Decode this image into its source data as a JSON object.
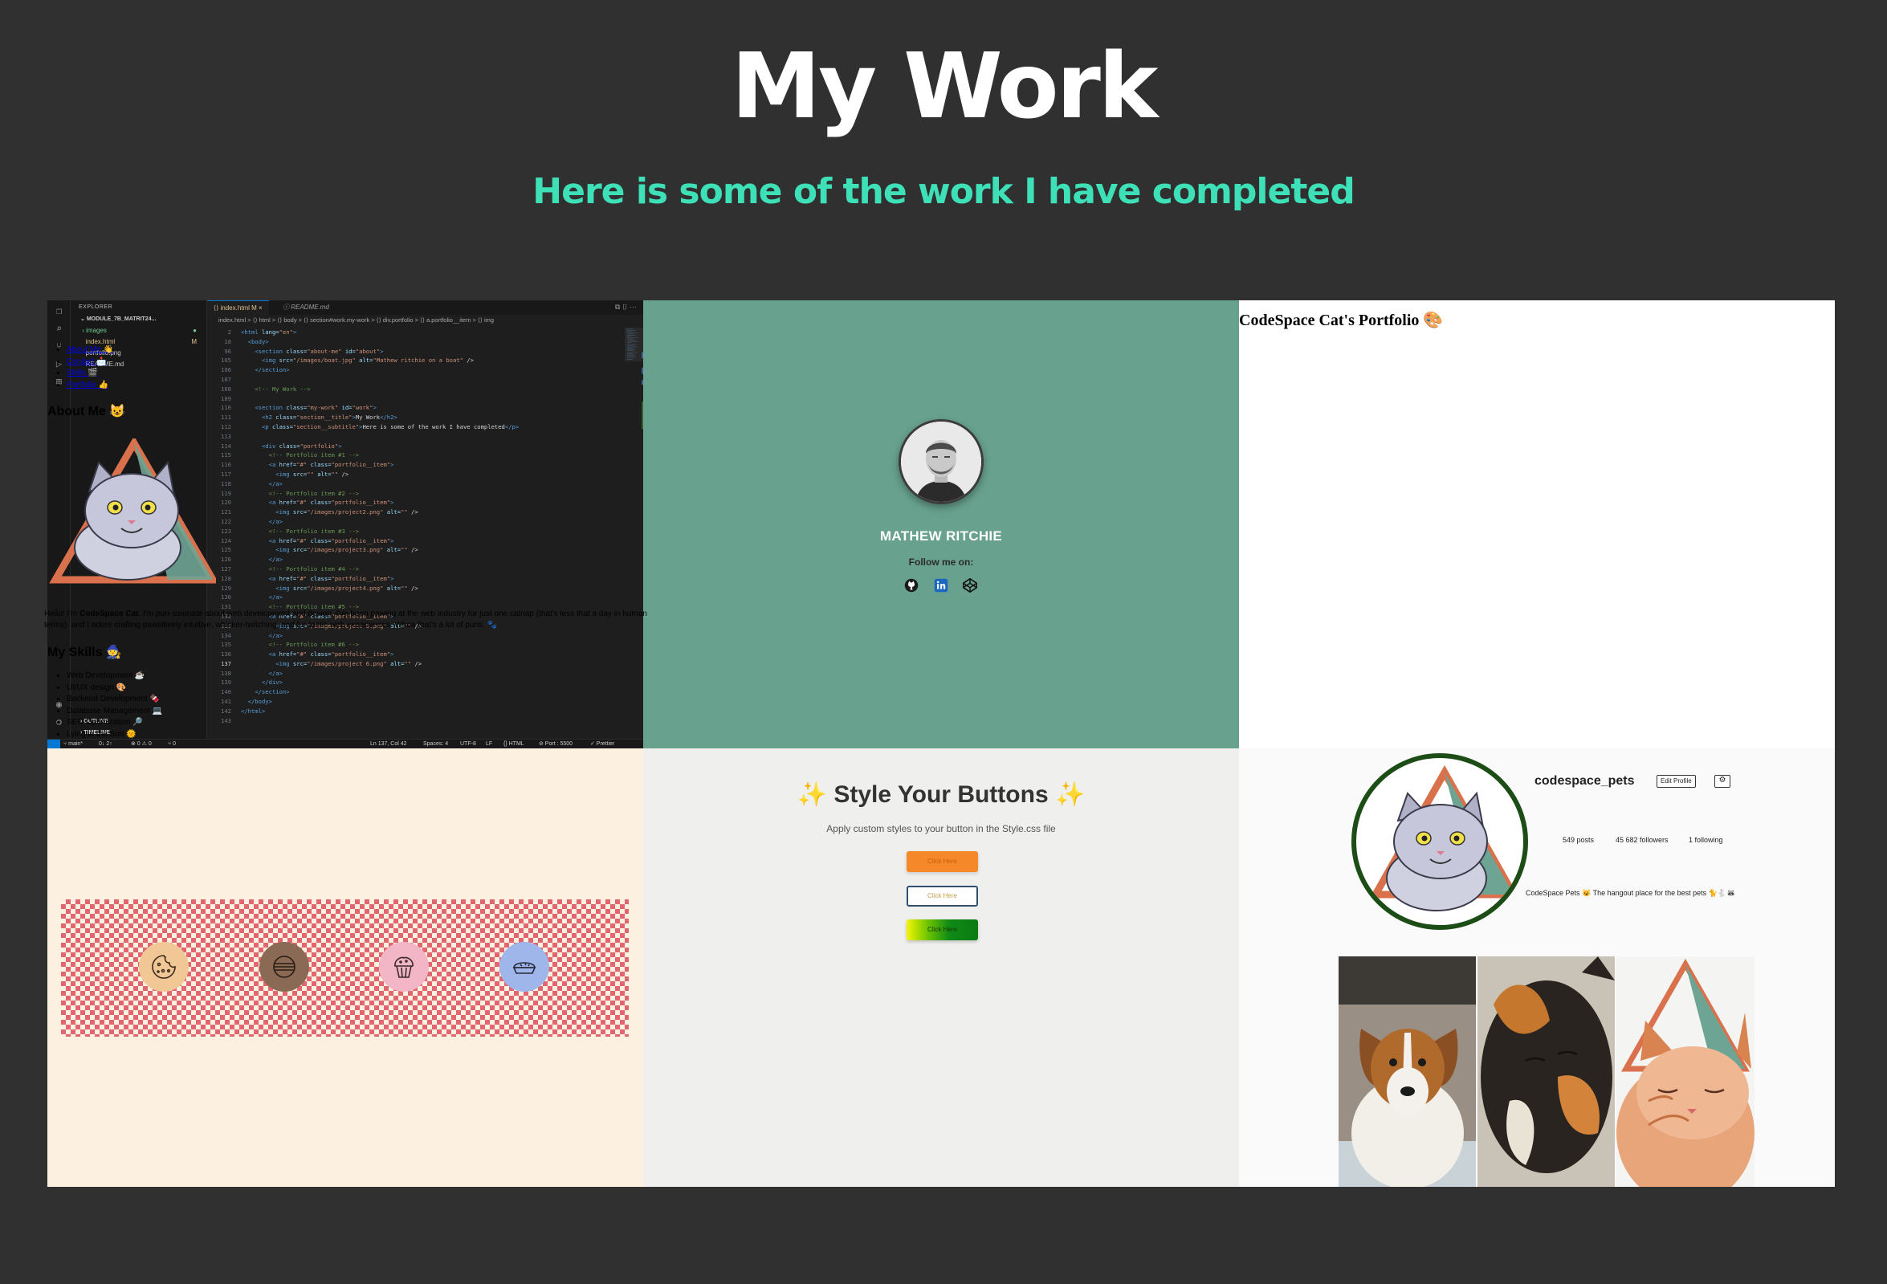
{
  "header": {
    "title": "My Work",
    "subtitle": "Here is some of the work I have completed"
  },
  "portfolio": {
    "item1": {
      "explorer_label": "EXPLORER",
      "project_folder": "MODULE_7B_MATRIT24...",
      "files": [
        {
          "name": "images",
          "mark": "●"
        },
        {
          "name": "index.html",
          "mark": "M"
        },
        {
          "name": "portfolio.png",
          "mark": ""
        },
        {
          "name": "README.md",
          "mark": ""
        }
      ],
      "outline_label": "OUTLINE",
      "timeline_label": "TIMELINE",
      "tabs": [
        "index.html M",
        "README.md"
      ],
      "breadcrumbs": "index.html  >  ⟨⟩ html  >  ⟨⟩ body  >  ⟨⟩ section#work.my-work  >  ⟨⟩ div.portfolio  >  ⟨⟩ a.portfolio__item  >  ⟨⟩ img",
      "code_lines": [
        {
          "n": "2",
          "t": "<html lang=\"en\">"
        },
        {
          "n": "18",
          "t": "  <body>"
        },
        {
          "n": "96",
          "t": "    <section class=\"about-me\" id=\"about\">"
        },
        {
          "n": "105",
          "t": "      <img src=\"/images/boat.jpg\" alt=\"Mathew ritchie on a boat\" />"
        },
        {
          "n": "106",
          "t": "    </section>"
        },
        {
          "n": "107",
          "t": ""
        },
        {
          "n": "108",
          "t": "    <!-- My Work -->"
        },
        {
          "n": "109",
          "t": ""
        },
        {
          "n": "110",
          "t": "    <section class=\"my-work\" id=\"work\">"
        },
        {
          "n": "111",
          "t": "      <h2 class=\"section__title\">My Work</h2>"
        },
        {
          "n": "112",
          "t": "      <p class=\"section__subtitle\">Here is some of the work I have completed</p>"
        },
        {
          "n": "113",
          "t": ""
        },
        {
          "n": "114",
          "t": "      <div class=\"portfolio\">"
        },
        {
          "n": "115",
          "t": "        <!-- Portfolio item #1 -->"
        },
        {
          "n": "116",
          "t": "        <a href=\"#\" class=\"portfolio__item\">"
        },
        {
          "n": "117",
          "t": "          <img src=\"\" alt=\"\" />"
        },
        {
          "n": "118",
          "t": "        </a>"
        },
        {
          "n": "119",
          "t": "        <!-- Portfolio item #2 -->"
        },
        {
          "n": "120",
          "t": "        <a href=\"#\" class=\"portfolio__item\">"
        },
        {
          "n": "121",
          "t": "          <img src=\"/images/project2.png\" alt=\"\" />"
        },
        {
          "n": "122",
          "t": "        </a>"
        },
        {
          "n": "123",
          "t": "        <!-- Portfolio item #3 -->"
        },
        {
          "n": "124",
          "t": "        <a href=\"#\" class=\"portfolio__item\">"
        },
        {
          "n": "125",
          "t": "          <img src=\"/images/project3.png\" alt=\"\" />"
        },
        {
          "n": "126",
          "t": "        </a>"
        },
        {
          "n": "127",
          "t": "        <!-- Portfolio item #4 -->"
        },
        {
          "n": "128",
          "t": "        <a href=\"#\" class=\"portfolio__item\">"
        },
        {
          "n": "129",
          "t": "          <img src=\"/images/project4.png\" alt=\"\" />"
        },
        {
          "n": "130",
          "t": "        </a>"
        },
        {
          "n": "131",
          "t": "        <!-- Portfolio item #5 -->"
        },
        {
          "n": "132",
          "t": "        <a href=\"#\" class=\"portfolio__item\">"
        },
        {
          "n": "133",
          "t": "          <img src=\"/images/project 5.png\" alt=\"\" />"
        },
        {
          "n": "134",
          "t": "        </a>"
        },
        {
          "n": "135",
          "t": "        <!-- Portfolio item #6 -->"
        },
        {
          "n": "136",
          "t": "        <a href=\"#\" class=\"portfolio__item\">"
        },
        {
          "n": "137",
          "t": "          <img src=\"/images/project 6.png\" alt=\"\" />"
        },
        {
          "n": "138",
          "t": "        </a>"
        },
        {
          "n": "139",
          "t": "      </div>"
        },
        {
          "n": "140",
          "t": "    </section>"
        },
        {
          "n": "141",
          "t": "  </body>"
        },
        {
          "n": "142",
          "t": "</html>"
        },
        {
          "n": "143",
          "t": ""
        }
      ],
      "status": {
        "branch": "main*",
        "sync": "0↓ 2↑",
        "problems": "⊗ 0 ⚠ 0",
        "ports": "⑂ 0",
        "position": "Ln 137, Col 42",
        "spaces": "Spaces: 4",
        "encoding": "UTF-8",
        "eol": "LF",
        "language": "{} HTML",
        "port": "⊘ Port : 5500",
        "prettier": "✓ Prettier"
      }
    },
    "item2": {
      "name": "MATHEW RITCHIE",
      "follow": "Follow me on:",
      "background": "#68a28f"
    },
    "item3": {
      "title": "CodeSpace Cat's Portfolio 🎨",
      "nav": [
        "About Me 👋",
        "Contact 📩",
        "Skills 🎬",
        "Portfolio 👍"
      ],
      "about_heading": "About Me 😺",
      "about_text_1": "Hello! I'm ",
      "about_bold": "CodeSpace Cat",
      "about_text_2": ". I'm purr-ssionate about web development and design. I've been pawing at the web industry for just one catnap (that's less that a day in human",
      "about_text_3": "terms). and I adore crafting pawsitively intuitive, whisker-twitching, and fur-tastic web experiences. Whoa that's a lot of puns. 🐾",
      "skills_heading": "My Skills 🧙",
      "skills": [
        "Web Development ☕",
        "UI/UX design 🎨",
        "Backend Development 🍫",
        "Database Management 💻",
        "SEO Optimization 🔎",
        "Lying in the Sun 🌞"
      ]
    },
    "item4": {
      "background": "#fcf1e1",
      "icons": [
        "cookie-icon",
        "macaron-icon",
        "muffin-icon",
        "pie-icon"
      ],
      "icon_colors": [
        "#f1c895",
        "#8a6a55",
        "#f2b6c6",
        "#9eb6ea"
      ]
    },
    "item5": {
      "title": "✨ Style Your Buttons ✨",
      "subtitle": "Apply custom styles to your button in the Style.css file",
      "buttons": [
        "Click Here",
        "Click Here",
        "Click Here"
      ]
    },
    "item6": {
      "username": "codespace_pets",
      "edit_label": "Edit Profile",
      "gear": "⚙",
      "posts": "549 posts",
      "followers": "45 682 followers",
      "following": "1 following",
      "bio": "CodeSpace Pets 😺 The hangout place for the best pets 🐈🐇🦝",
      "ring_color": "#1c4d16"
    }
  }
}
